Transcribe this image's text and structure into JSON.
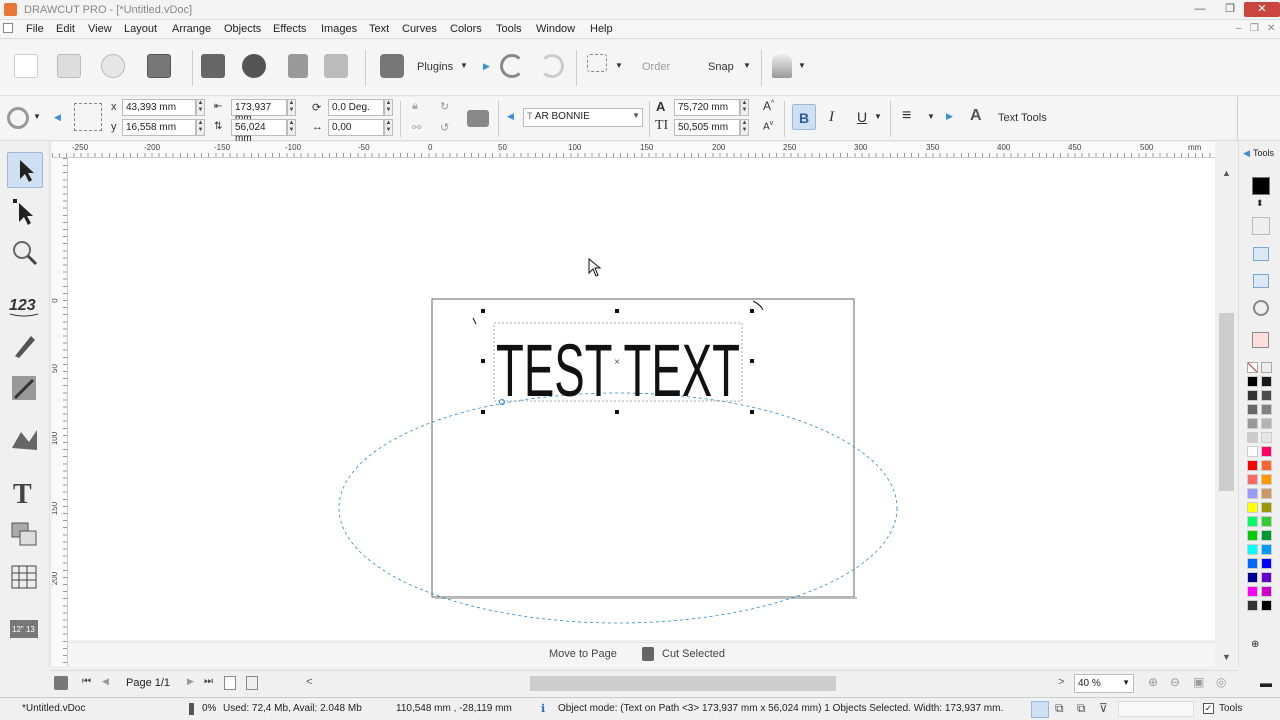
{
  "window": {
    "title": "DRAWCUT PRO - [*Untitled.vDoc]",
    "minimize": "—",
    "restore": "❐",
    "close": "✕"
  },
  "menu": [
    "File",
    "Edit",
    "View",
    "Layout",
    "Arrange",
    "Objects",
    "Effects",
    "Images",
    "Text",
    "Curves",
    "Colors",
    "Tools",
    "Window",
    "Help"
  ],
  "toolbar": {
    "plugins": "Plugins",
    "order": "Order",
    "snap": "Snap"
  },
  "props": {
    "x_label": "x",
    "y_label": "y",
    "x": "43,393 mm",
    "y": "16,558 mm",
    "width": "173,937 mm",
    "height": "56,024 mm",
    "rotation": "0,0 Deg.",
    "skew": "0,00",
    "font": "AR BONNIE",
    "font_size": "75,720 mm",
    "line_height": "50,505 mm",
    "bold": "B",
    "italic": "I",
    "underline": "U",
    "text_tools": "Text Tools"
  },
  "ruler_h": [
    "-250",
    "-200",
    "-150",
    "-100",
    "-50",
    "0",
    "50",
    "100",
    "150",
    "200",
    "250",
    "300",
    "350",
    "400",
    "450",
    "500",
    "mm"
  ],
  "ruler_v": [
    "0",
    "50",
    "100",
    "150",
    "200"
  ],
  "canvas": {
    "text": "TEST TEXT"
  },
  "page_actions": {
    "move": "Move to Page",
    "cut": "Cut Selected"
  },
  "nav": {
    "page": "Page 1/1",
    "zoom": "40 %"
  },
  "right_panel": {
    "tools_label": "Tools"
  },
  "palette": [
    "#000000",
    "#1a1a1a",
    "#333333",
    "#4d4d4d",
    "#666666",
    "#808080",
    "#999999",
    "#b3b3b3",
    "#cccccc",
    "#e6e6e6",
    "#ffffff",
    "#ff0066",
    "#ff0000",
    "#ff6633",
    "#ff6666",
    "#ff9900",
    "#9999ff",
    "#cc9966",
    "#ffff00",
    "#999900",
    "#00ff66",
    "#33cc33",
    "#00cc00",
    "#009933",
    "#00ffff",
    "#0099ff",
    "#0066ff",
    "#0000ff",
    "#000099",
    "#6600cc",
    "#ff00ff",
    "#cc00cc",
    "#333333",
    "#000000"
  ],
  "status": {
    "file": "*Untitled.vDoc",
    "progress": "0%",
    "memory": "Used: 72,4 Mb, Avail: 2.048 Mb",
    "coords": "110,548 mm , -28,119 mm",
    "info": "Object mode: (Text on Path <3> 173,937 mm x 56,024 mm) 1 Objects Selected. Width: 173,937 mm.",
    "tools": "Tools"
  }
}
